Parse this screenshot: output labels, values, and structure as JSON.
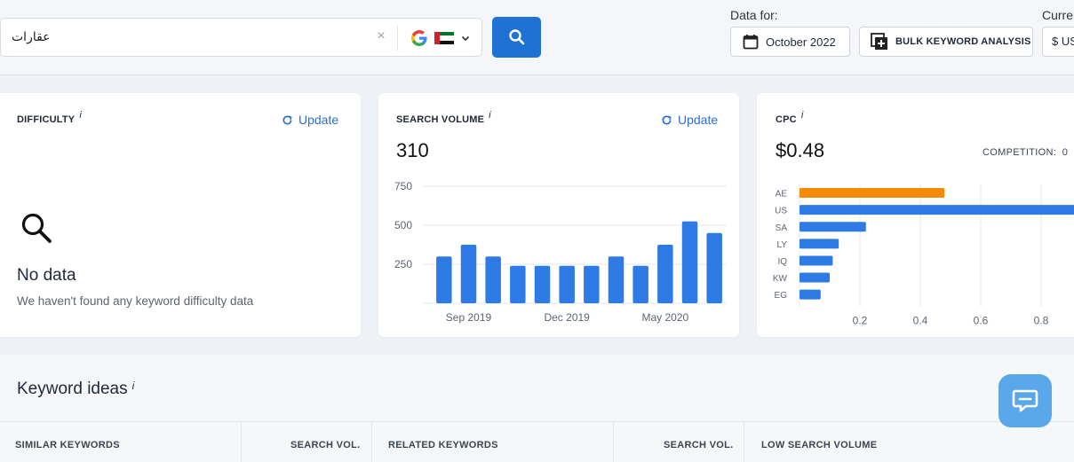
{
  "search": {
    "query": "عقارات",
    "clear_symbol": "×"
  },
  "data_for": {
    "label": "Data for:",
    "month": "October 2022"
  },
  "bulk_button": "BULK KEYWORD ANALYSIS",
  "currency": {
    "label": "Currency",
    "value": "$ USD"
  },
  "difficulty": {
    "title": "DIFFICULTY",
    "info": "i",
    "update": "Update",
    "no_data_title": "No data",
    "no_data_sub": "We haven't found any keyword difficulty data"
  },
  "search_volume": {
    "title": "SEARCH VOLUME",
    "info": "i",
    "update": "Update",
    "value": "310"
  },
  "cpc": {
    "title": "CPC",
    "info": "i",
    "value": "$0.48",
    "competition_label": "COMPETITION:",
    "competition_value": "0"
  },
  "keyword_ideas": {
    "title": "Keyword ideas",
    "info": "i",
    "columns": [
      "SIMILAR KEYWORDS",
      "SEARCH VOL.",
      "RELATED KEYWORDS",
      "SEARCH VOL.",
      "LOW SEARCH VOLUME"
    ]
  },
  "colors": {
    "primary": "#1f72d3",
    "bar_blue": "#2f7be6",
    "bar_orange": "#f58a07",
    "link": "#2a6fcf"
  },
  "icons": {
    "search": "search-icon",
    "calendar": "calendar-icon",
    "add_bulk": "add-box-icon",
    "refresh": "refresh-icon",
    "magnifier": "magnifier-icon",
    "chat": "chat-icon",
    "google": "google-icon",
    "flag": "uae-flag-icon"
  },
  "chart_data": [
    {
      "type": "bar",
      "title": "",
      "categories": [
        "",
        "",
        "",
        "",
        "",
        "",
        "",
        "",
        "",
        "",
        "",
        ""
      ],
      "x_tick_labels": [
        "Sep 2019",
        "Dec 2019",
        "May 2020"
      ],
      "values": [
        300,
        375,
        300,
        240,
        240,
        240,
        240,
        300,
        240,
        375,
        525,
        450
      ],
      "ylim": [
        0,
        750
      ],
      "yticks": [
        250,
        500,
        750
      ],
      "grid": true
    },
    {
      "type": "bar",
      "orientation": "horizontal",
      "categories": [
        "AE",
        "US",
        "SA",
        "LY",
        "IQ",
        "KW",
        "EG"
      ],
      "values": [
        0.48,
        0.95,
        0.22,
        0.13,
        0.11,
        0.1,
        0.07
      ],
      "highlight": "AE",
      "xticks": [
        0.2,
        0.4,
        0.6,
        0.8
      ],
      "xlim": [
        0,
        0.9
      ],
      "grid": true
    }
  ]
}
